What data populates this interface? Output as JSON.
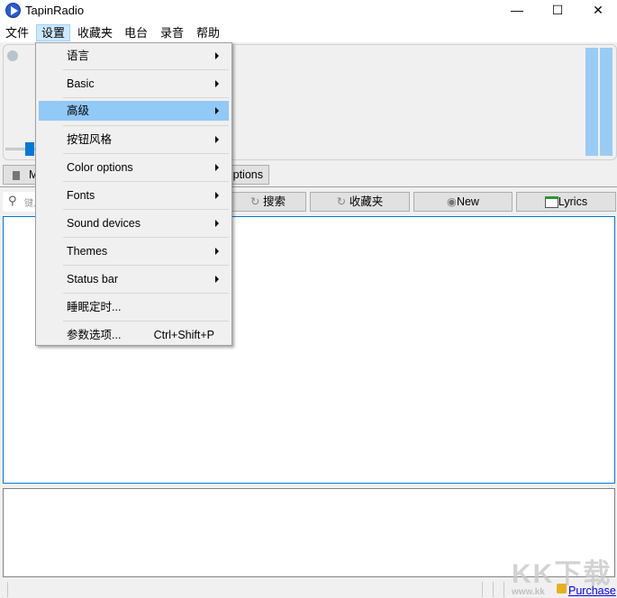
{
  "window": {
    "title": "TapinRadio",
    "minimize": "—",
    "maximize": "☐",
    "close": "✕"
  },
  "menubar": [
    "文件",
    "设置",
    "收藏夹",
    "电台",
    "录音",
    "帮助"
  ],
  "settings_menu": {
    "items": [
      {
        "label": "语言",
        "submenu": true
      },
      {
        "label": "Basic",
        "submenu": true
      },
      {
        "label": "高级",
        "submenu": true,
        "highlighted": true
      },
      {
        "label": "按钮风格",
        "submenu": true
      },
      {
        "label": "Color options",
        "submenu": true
      },
      {
        "label": "Fonts",
        "submenu": true
      },
      {
        "label": "Sound devices",
        "submenu": true
      },
      {
        "label": "Themes",
        "submenu": true
      },
      {
        "label": "Status bar",
        "submenu": true
      },
      {
        "label": "睡眠定时...",
        "submenu": false
      },
      {
        "label": "参数选项...",
        "submenu": false,
        "shortcut": "Ctrl+Shift+P"
      }
    ]
  },
  "toolbar": {
    "mute_label": "M",
    "options_label": "Options"
  },
  "search": {
    "placeholder": "键入",
    "search_button": "搜索",
    "favorites_button": "收藏夹",
    "new_button": "New",
    "lyrics_button": "Lyrics"
  },
  "statusbar": {
    "purchase": "Purchase"
  },
  "watermark": {
    "text": "KK下载",
    "url": "www.kk"
  },
  "colors": {
    "accent": "#0078d7",
    "highlight": "#91c9f7"
  }
}
